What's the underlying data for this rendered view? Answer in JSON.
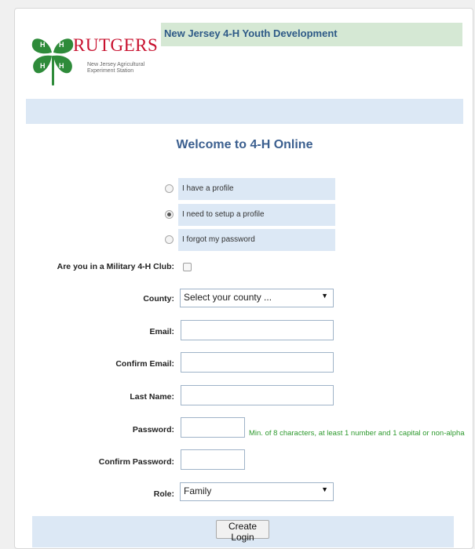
{
  "header": {
    "brand": "RUTGERS",
    "brand_subtitle": "New Jersey Agricultural Experiment Station",
    "title": "New Jersey 4-H Youth Development"
  },
  "welcome": "Welcome to 4-H Online",
  "options": [
    {
      "label": "I have a profile",
      "checked": false
    },
    {
      "label": "I need to setup a profile",
      "checked": true
    },
    {
      "label": "I forgot my password",
      "checked": false
    }
  ],
  "form": {
    "military_label": "Are you in a Military 4-H Club:",
    "military_checked": false,
    "county_label": "County:",
    "county_value": "Select your county ...",
    "email_label": "Email:",
    "email_value": "",
    "confirm_email_label": "Confirm Email:",
    "confirm_email_value": "",
    "last_name_label": "Last Name:",
    "last_name_value": "",
    "password_label": "Password:",
    "password_value": "",
    "password_hint": "Min. of 8 characters, at least 1 number and 1 capital or non-alpha",
    "confirm_password_label": "Confirm Password:",
    "confirm_password_value": "",
    "role_label": "Role:",
    "role_value": "Family",
    "submit_label": "Create Login"
  },
  "colors": {
    "brand_red": "#c8102e",
    "clover_green": "#2e8b3a",
    "header_green": "#d5e8d4",
    "band_blue": "#dce8f5",
    "title_blue": "#3b5f8f",
    "hint_green": "#2e9a2e"
  },
  "icons": {
    "logo": "4-h-clover-icon",
    "dropdown": "dropdown-arrow-icon"
  }
}
